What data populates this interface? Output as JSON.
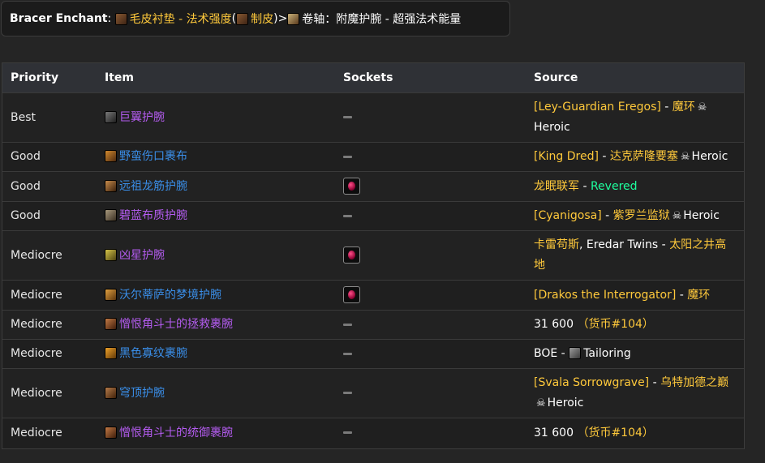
{
  "enchant": {
    "label": "Bracer Enchant",
    "colon": ":",
    "hide_name": "毛皮衬垫 - 法术强度",
    "paren_open": " (",
    "profession": "制皮",
    "paren_close": ")",
    "arrow": " > ",
    "scroll_name": "卷轴：附魔护腕 - 超强法术能量"
  },
  "table": {
    "headers": [
      "Priority",
      "Item",
      "Sockets",
      "Source"
    ],
    "rows": [
      {
        "priority": "Best",
        "item": "巨翼护腕",
        "item_color": "purple",
        "icon": "bracer1",
        "socket": "none",
        "source_parts": [
          {
            "t": "[Ley-Guardian Eregos]",
            "c": "gold"
          },
          {
            "t": " - ",
            "c": "white"
          },
          {
            "t": "魔环",
            "c": "gold"
          },
          {
            "t": "skull",
            "c": "icon"
          },
          {
            "t": "Heroic",
            "c": "white"
          }
        ]
      },
      {
        "priority": "Good",
        "item": "野蛮伤口裹布",
        "item_color": "blue",
        "icon": "bracer2",
        "socket": "none",
        "source_parts": [
          {
            "t": "[King Dred]",
            "c": "gold"
          },
          {
            "t": " - ",
            "c": "white"
          },
          {
            "t": "达克萨隆要塞",
            "c": "gold"
          },
          {
            "t": "skull",
            "c": "icon"
          },
          {
            "t": "Heroic",
            "c": "white"
          }
        ]
      },
      {
        "priority": "Good",
        "item": "远祖龙筋护腕",
        "item_color": "blue",
        "icon": "bracer3",
        "socket": "red",
        "source_parts": [
          {
            "t": "龙眠联军",
            "c": "gold"
          },
          {
            "t": " - ",
            "c": "white"
          },
          {
            "t": "Revered",
            "c": "green"
          }
        ]
      },
      {
        "priority": "Good",
        "item": "碧蓝布质护腕",
        "item_color": "purple",
        "icon": "bracer4",
        "socket": "none",
        "source_parts": [
          {
            "t": "[Cyanigosa]",
            "c": "gold"
          },
          {
            "t": " - ",
            "c": "white"
          },
          {
            "t": "紫罗兰监狱",
            "c": "gold"
          },
          {
            "t": "skull",
            "c": "icon"
          },
          {
            "t": "Heroic",
            "c": "white"
          }
        ]
      },
      {
        "priority": "Mediocre",
        "item": "凶星护腕",
        "item_color": "purple",
        "icon": "bracer5",
        "socket": "red",
        "source_parts": [
          {
            "t": "卡雷苟斯",
            "c": "gold"
          },
          {
            "t": ", Eredar Twins",
            "c": "white"
          },
          {
            "t": " - ",
            "c": "white"
          },
          {
            "t": "太阳之井高地",
            "c": "gold"
          }
        ]
      },
      {
        "priority": "Mediocre",
        "item": "沃尔蒂萨的梦境护腕",
        "item_color": "blue",
        "icon": "bracer6",
        "socket": "red",
        "source_parts": [
          {
            "t": "[Drakos the Interrogator]",
            "c": "gold"
          },
          {
            "t": " - ",
            "c": "white"
          },
          {
            "t": "魔环",
            "c": "gold"
          }
        ]
      },
      {
        "priority": "Mediocre",
        "item": "憎恨角斗士的拯救裹腕",
        "item_color": "purple",
        "icon": "bracer7",
        "socket": "none",
        "source_parts": [
          {
            "t": "31 600",
            "c": "white"
          },
          {
            "t": " （货币#104）",
            "c": "gold"
          }
        ]
      },
      {
        "priority": "Mediocre",
        "item": "黑色寡纹裹腕",
        "item_color": "blue",
        "icon": "bracer8",
        "socket": "none",
        "source_parts": [
          {
            "t": "BOE - ",
            "c": "white"
          },
          {
            "t": "tailor",
            "c": "ticon"
          },
          {
            "t": "Tailoring",
            "c": "white"
          }
        ]
      },
      {
        "priority": "Mediocre",
        "item": "穹顶护腕",
        "item_color": "blue",
        "icon": "bracer9",
        "socket": "none",
        "source_parts": [
          {
            "t": "[Svala Sorrowgrave]",
            "c": "gold"
          },
          {
            "t": " - ",
            "c": "white"
          },
          {
            "t": "乌特加德之巅",
            "c": "gold"
          },
          {
            "t": "skull",
            "c": "icon"
          },
          {
            "t": "Heroic",
            "c": "white"
          }
        ]
      },
      {
        "priority": "Mediocre",
        "item": "憎恨角斗士的统御裹腕",
        "item_color": "purple",
        "icon": "bracer7",
        "socket": "none",
        "source_parts": [
          {
            "t": "31 600",
            "c": "white"
          },
          {
            "t": " （货币#104）",
            "c": "gold"
          }
        ]
      }
    ]
  }
}
